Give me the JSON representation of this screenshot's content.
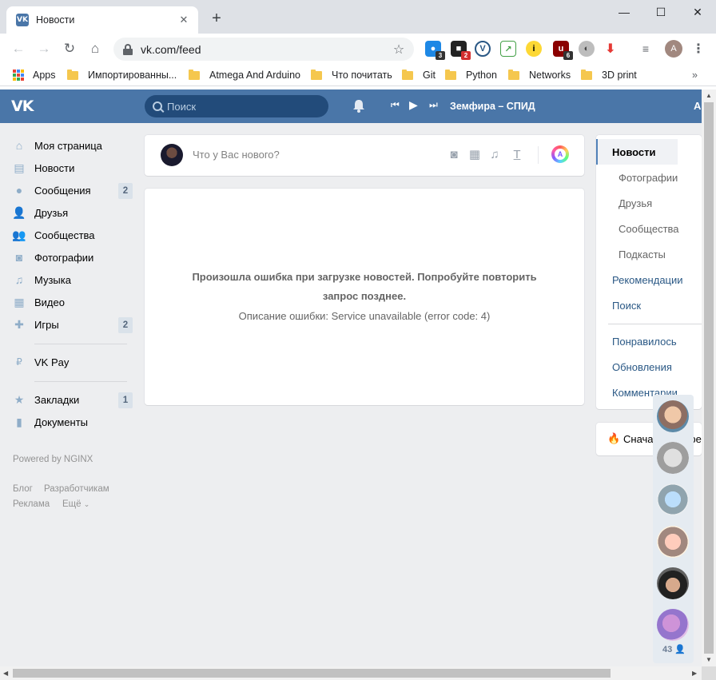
{
  "browser": {
    "tab_title": "Новости",
    "url": "vk.com/feed",
    "profile_initial": "A",
    "extension_badges": [
      "3",
      "2",
      "6"
    ],
    "bookmarks": [
      "Apps",
      "Импортированны...",
      "Atmega And Arduino",
      "Что почитать",
      "Git",
      "Python",
      "Networks",
      "3D print"
    ]
  },
  "vk": {
    "search_placeholder": "Поиск",
    "now_playing": "Земфира – СПИД",
    "header_cut": "A"
  },
  "left_menu": {
    "items": [
      {
        "label": "Моя страница",
        "icon": "home-icon"
      },
      {
        "label": "Новости",
        "icon": "news-icon"
      },
      {
        "label": "Сообщения",
        "icon": "messages-icon",
        "count": "2"
      },
      {
        "label": "Друзья",
        "icon": "friends-icon"
      },
      {
        "label": "Сообщества",
        "icon": "communities-icon"
      },
      {
        "label": "Фотографии",
        "icon": "camera-icon"
      },
      {
        "label": "Музыка",
        "icon": "music-icon"
      },
      {
        "label": "Видео",
        "icon": "video-icon"
      },
      {
        "label": "Игры",
        "icon": "games-icon",
        "count": "2"
      }
    ],
    "vkpay": "VK Pay",
    "extra": [
      {
        "label": "Закладки",
        "icon": "star-icon",
        "count": "1"
      },
      {
        "label": "Документы",
        "icon": "document-icon"
      }
    ],
    "powered": "Powered by NGINX",
    "footer_links": [
      "Блог",
      "Разработчикам",
      "Реклама",
      "Ещё"
    ]
  },
  "post": {
    "placeholder": "Что у Вас нового?",
    "color_letter": "A"
  },
  "feed_error": {
    "line1": "Произошла ошибка при загрузке новостей. Попробуйте повторить",
    "line2": "запрос позднее.",
    "desc": "Описание ошибки: Service unavailable (error code: 4)"
  },
  "right_menu": {
    "items": [
      "Новости",
      "Фотографии",
      "Друзья",
      "Сообщества",
      "Подкасты",
      "Рекомендации",
      "Поиск"
    ],
    "items2": [
      "Понравилось",
      "Обновления",
      "Комментарии"
    ],
    "hot_label": "Сначала интерес"
  },
  "chat": {
    "online_count": "43"
  },
  "colors": {
    "vk_blue": "#4a76a8",
    "page_bg": "#edeef0",
    "link": "#2a5885"
  }
}
